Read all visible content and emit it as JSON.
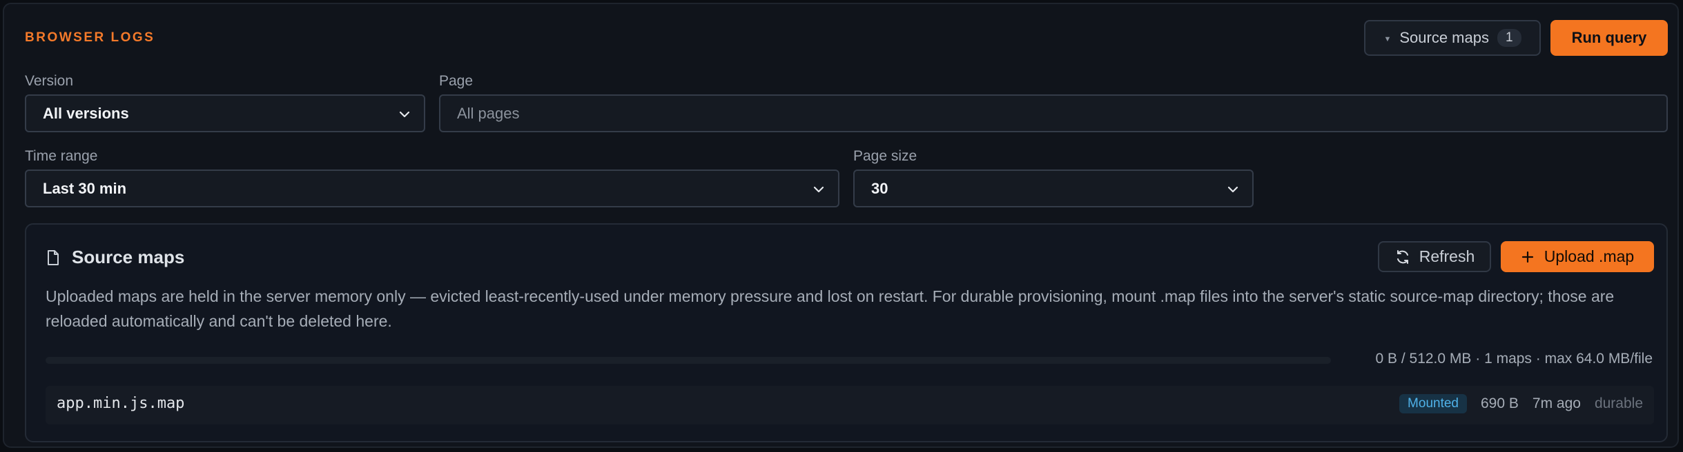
{
  "header": {
    "title": "BROWSER LOGS",
    "source_maps_label": "Source maps",
    "source_maps_count": "1",
    "run_query_label": "Run query"
  },
  "filters": {
    "version": {
      "label": "Version",
      "value": "All versions"
    },
    "page": {
      "label": "Page",
      "placeholder": "All pages"
    },
    "time_range": {
      "label": "Time range",
      "value": "Last 30 min"
    },
    "page_size": {
      "label": "Page size",
      "value": "30"
    }
  },
  "source_maps": {
    "title": "Source maps",
    "refresh_label": "Refresh",
    "upload_label": "Upload .map",
    "description": "Uploaded maps are held in the server memory only — evicted least-recently-used under memory pressure and lost on restart. For durable provisioning, mount .map files into the server's static source-map directory; those are reloaded automatically and can't be deleted here.",
    "quota_text": "0 B / 512.0 MB · 1 maps · max 64.0 MB/file",
    "quota_used_fraction": 0.0,
    "files": [
      {
        "name": "app.min.js.map",
        "status": "Mounted",
        "size": "690 B",
        "age": "7m ago",
        "storage": "durable"
      }
    ]
  },
  "icons": {
    "chevron": "chevron-down-icon",
    "file": "file-icon",
    "refresh": "refresh-icon",
    "plus": "plus-icon"
  },
  "colors": {
    "accent": "#f47520",
    "status_mounted": "#4fb1e8"
  }
}
